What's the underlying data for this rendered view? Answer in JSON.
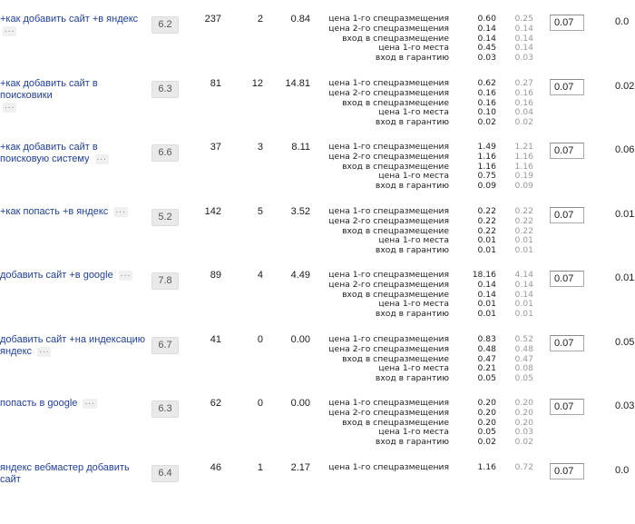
{
  "position_labels": [
    "цена 1-го спецразмещения",
    "цена 2-го спецразмещения",
    "вход в спецразмещение",
    "цена 1-го места",
    "вход в гарантию"
  ],
  "more_label": "...",
  "rows": [
    {
      "phrase": "+как добавить сайт +в яндекс",
      "show_more_inline": false,
      "score": "6.2",
      "shows": "237",
      "clicks": "2",
      "ctr": "0.84",
      "prices": [
        "0.60",
        "0.14",
        "0.14",
        "0.45",
        "0.03"
      ],
      "prices2": [
        "0.25",
        "0.14",
        "0.14",
        "0.14",
        "0.03"
      ],
      "bid": "0.07",
      "last": "0.0"
    },
    {
      "phrase": "+как добавить сайт в поисковики",
      "show_more_inline": false,
      "score": "6.3",
      "shows": "81",
      "clicks": "12",
      "ctr": "14.81",
      "prices": [
        "0.62",
        "0.16",
        "0.16",
        "0.10",
        "0.02"
      ],
      "prices2": [
        "0.27",
        "0.16",
        "0.16",
        "0.04",
        "0.02"
      ],
      "bid": "0.07",
      "last": "0.02"
    },
    {
      "phrase": "+как добавить сайт в поисковую систему",
      "show_more_inline": true,
      "score": "6.6",
      "shows": "37",
      "clicks": "3",
      "ctr": "8.11",
      "prices": [
        "1.49",
        "1.16",
        "1.16",
        "0.75",
        "0.09"
      ],
      "prices2": [
        "1.21",
        "1.16",
        "1.16",
        "0.19",
        "0.09"
      ],
      "bid": "0.07",
      "last": "0.06"
    },
    {
      "phrase": "+как попасть +в яндекс",
      "show_more_inline": true,
      "score": "5.2",
      "shows": "142",
      "clicks": "5",
      "ctr": "3.52",
      "prices": [
        "0.22",
        "0.22",
        "0.22",
        "0.01",
        "0.01"
      ],
      "prices2": [
        "0.22",
        "0.22",
        "0.22",
        "0.01",
        "0.01"
      ],
      "bid": "0.07",
      "last": "0.01"
    },
    {
      "phrase": "добавить сайт +в google",
      "show_more_inline": true,
      "score": "7.8",
      "shows": "89",
      "clicks": "4",
      "ctr": "4.49",
      "prices": [
        "18.16",
        "0.14",
        "0.14",
        "0.01",
        "0.01"
      ],
      "prices2": [
        "4.14",
        "0.14",
        "0.14",
        "0.01",
        "0.01"
      ],
      "bid": "0.07",
      "last": "0.01"
    },
    {
      "phrase": "добавить сайт +на индексацию яндекс",
      "show_more_inline": true,
      "score": "6.7",
      "shows": "41",
      "clicks": "0",
      "ctr": "0.00",
      "prices": [
        "0.83",
        "0.48",
        "0.47",
        "0.21",
        "0.05"
      ],
      "prices2": [
        "0.52",
        "0.48",
        "0.47",
        "0.08",
        "0.05"
      ],
      "bid": "0.07",
      "last": "0.05"
    },
    {
      "phrase": "попасть в google",
      "show_more_inline": true,
      "score": "6.3",
      "shows": "62",
      "clicks": "0",
      "ctr": "0.00",
      "prices": [
        "0.20",
        "0.20",
        "0.20",
        "0.05",
        "0.02"
      ],
      "prices2": [
        "0.20",
        "0.20",
        "0.20",
        "0.03",
        "0.02"
      ],
      "bid": "0.07",
      "last": "0.03"
    },
    {
      "phrase": "яндекс вебмастер добавить сайт",
      "show_more_inline": false,
      "score": "6.4",
      "shows": "46",
      "clicks": "1",
      "ctr": "2.17",
      "prices": [
        "1.16"
      ],
      "prices2": [
        "0.72"
      ],
      "bid": "0.07",
      "last": "0.0"
    }
  ]
}
